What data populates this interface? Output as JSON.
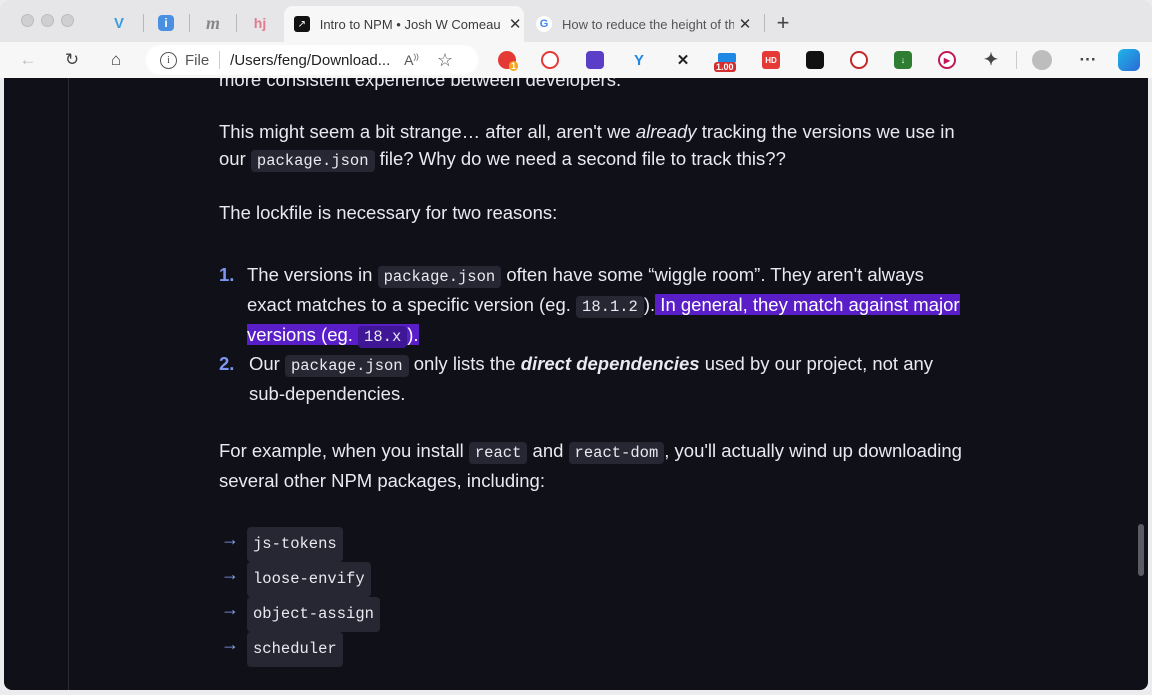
{
  "tabs": {
    "pinned": [
      {
        "name": "pinned-tab-v-icon",
        "glyph": "V",
        "color": "#3b9de0"
      },
      {
        "name": "pinned-tab-info-icon",
        "glyph": "i",
        "color": "#4a90e2"
      },
      {
        "name": "pinned-tab-m-icon",
        "glyph": "m",
        "color": "#888888"
      },
      {
        "name": "pinned-tab-hj-icon",
        "glyph": "hj",
        "color": "#e27b8f"
      }
    ],
    "active": {
      "title": "Intro to NPM • Josh W Comeau",
      "favicon": "↗"
    },
    "second": {
      "title": "How to reduce the height of th",
      "favicon": "G"
    },
    "new_tab": "+"
  },
  "toolbar": {
    "address_prefix": "File",
    "address_url": "/Users/feng/Download...",
    "zoom_badge": "1.00",
    "ext_badge_count": "1",
    "hd_label": "HD",
    "more": "···"
  },
  "article": {
    "intro_tail": "more consistent experience between developers.",
    "p1_a": "This might seem a bit strange… after all, aren't we ",
    "p1_em": "already",
    "p1_b": " tracking the versions we use in our ",
    "p1_code": "package.json",
    "p1_c": " file? Why do we need a second file to track this??",
    "p2": "The lockfile is necessary for two reasons:",
    "li1_num": "1.",
    "li1_a": "The versions in ",
    "li1_code": "package.json",
    "li1_b": " often have some “wiggle room”. They aren't always exact matches to a specific version (eg. ",
    "li1_code2": "18.1.2",
    "li1_c": ").",
    "li1_hl_a": " In general, they match against major versions (eg. ",
    "li1_hl_code": "18.x",
    "li1_hl_b": ").",
    "li2_num": "2.",
    "li2_a": "Our ",
    "li2_code": "package.json",
    "li2_b": " only lists the ",
    "li2_bi": "direct dependencies",
    "li2_c": " used by our project, not any sub-dependencies.",
    "p3_a": "For example, when you install ",
    "p3_code1": "react",
    "p3_b": " and ",
    "p3_code2": "react-dom",
    "p3_c": ", you'll actually wind up downloading several other NPM packages, including:",
    "packages": [
      "js-tokens",
      "loose-envify",
      "object-assign",
      "scheduler"
    ],
    "arrow": "→"
  }
}
